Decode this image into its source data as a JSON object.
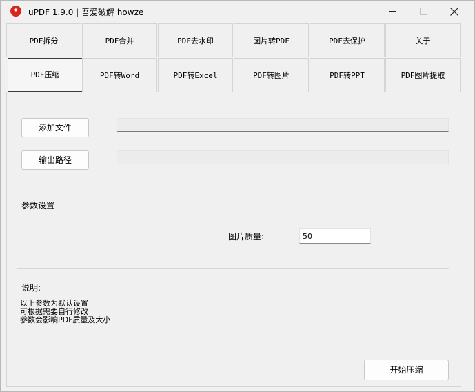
{
  "window": {
    "title": "uPDF 1.9.0 |  吾爱破解 howze",
    "app_icon_glyph": "✦"
  },
  "tabs": {
    "row1": [
      "PDF拆分",
      "PDF合并",
      "PDF去水印",
      "图片转PDF",
      "PDF去保护",
      "关于"
    ],
    "row2": [
      "PDF压缩",
      "PDF转Word",
      "PDF转Excel",
      "PDF转图片",
      "PDF转PPT",
      "PDF图片提取"
    ],
    "selected": "PDF压缩"
  },
  "main": {
    "add_file_label": "添加文件",
    "add_file_path": "",
    "output_path_label": "输出路径",
    "output_path_value": "",
    "params_group_label": "参数设置",
    "quality_label": "图片质量:",
    "quality_value": "50",
    "desc_group_label": "说明:",
    "desc_lines": [
      "以上参数为默认设置",
      "可根据需要自行修改",
      "参数会影响PDF质量及大小"
    ],
    "start_button_label": "开始压缩"
  },
  "icons": {
    "app": "updf-app-icon",
    "minimize": "minimize-icon",
    "maximize": "maximize-icon",
    "close": "close-icon"
  },
  "colors": {
    "background": "#f0f0f0",
    "app_icon": "#d9261c",
    "selected_tab_border": "#3a3a3a"
  }
}
